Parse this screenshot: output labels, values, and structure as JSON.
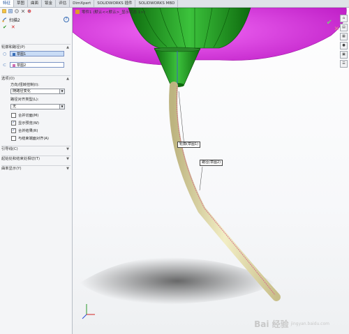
{
  "tabs": [
    "特征",
    "草图",
    "曲面",
    "钣金",
    "评估",
    "DimXpert",
    "SOLIDWORKS 插件",
    "SOLIDWORKS MBD"
  ],
  "feature": {
    "title": "扫描2",
    "help": "?",
    "ok": "✔",
    "cancel": "✕"
  },
  "profile_path": {
    "header": "轮廓和路径(P)",
    "profile_value": "草图1",
    "path_value": "草图2"
  },
  "options": {
    "header": "选项(O)",
    "orientation_label": "方向/扭转控制(I):",
    "orientation_value": "随路径变化",
    "path_align_label": "路径对齐类型(L):",
    "path_align_value": "无",
    "checkboxes": [
      {
        "label": "合并切面(M)",
        "checked": false
      },
      {
        "label": "显示预览(W)",
        "checked": true
      },
      {
        "label": "合并结果(R)",
        "checked": true
      },
      {
        "label": "与结束端面对齐(A)",
        "checked": false
      }
    ]
  },
  "collapsed_groups": [
    "引导线(C)",
    "起始处和结束处相切(T)",
    "曲率显示(Y)"
  ],
  "viewport": {
    "title": "零件1 (默认<<默认>_显示状态 1>)",
    "callout_profile": "轮廓(草图1)",
    "callout_path": "路径(草图2)",
    "watermark": "Bai 经验",
    "watermark_sub": "jingyan.baidu.com"
  },
  "colors": {
    "accent": "#1a4f9c",
    "magenta_body": "#e040e6",
    "green_body": "#1e9a1e",
    "tube": "#e8e2b0"
  }
}
